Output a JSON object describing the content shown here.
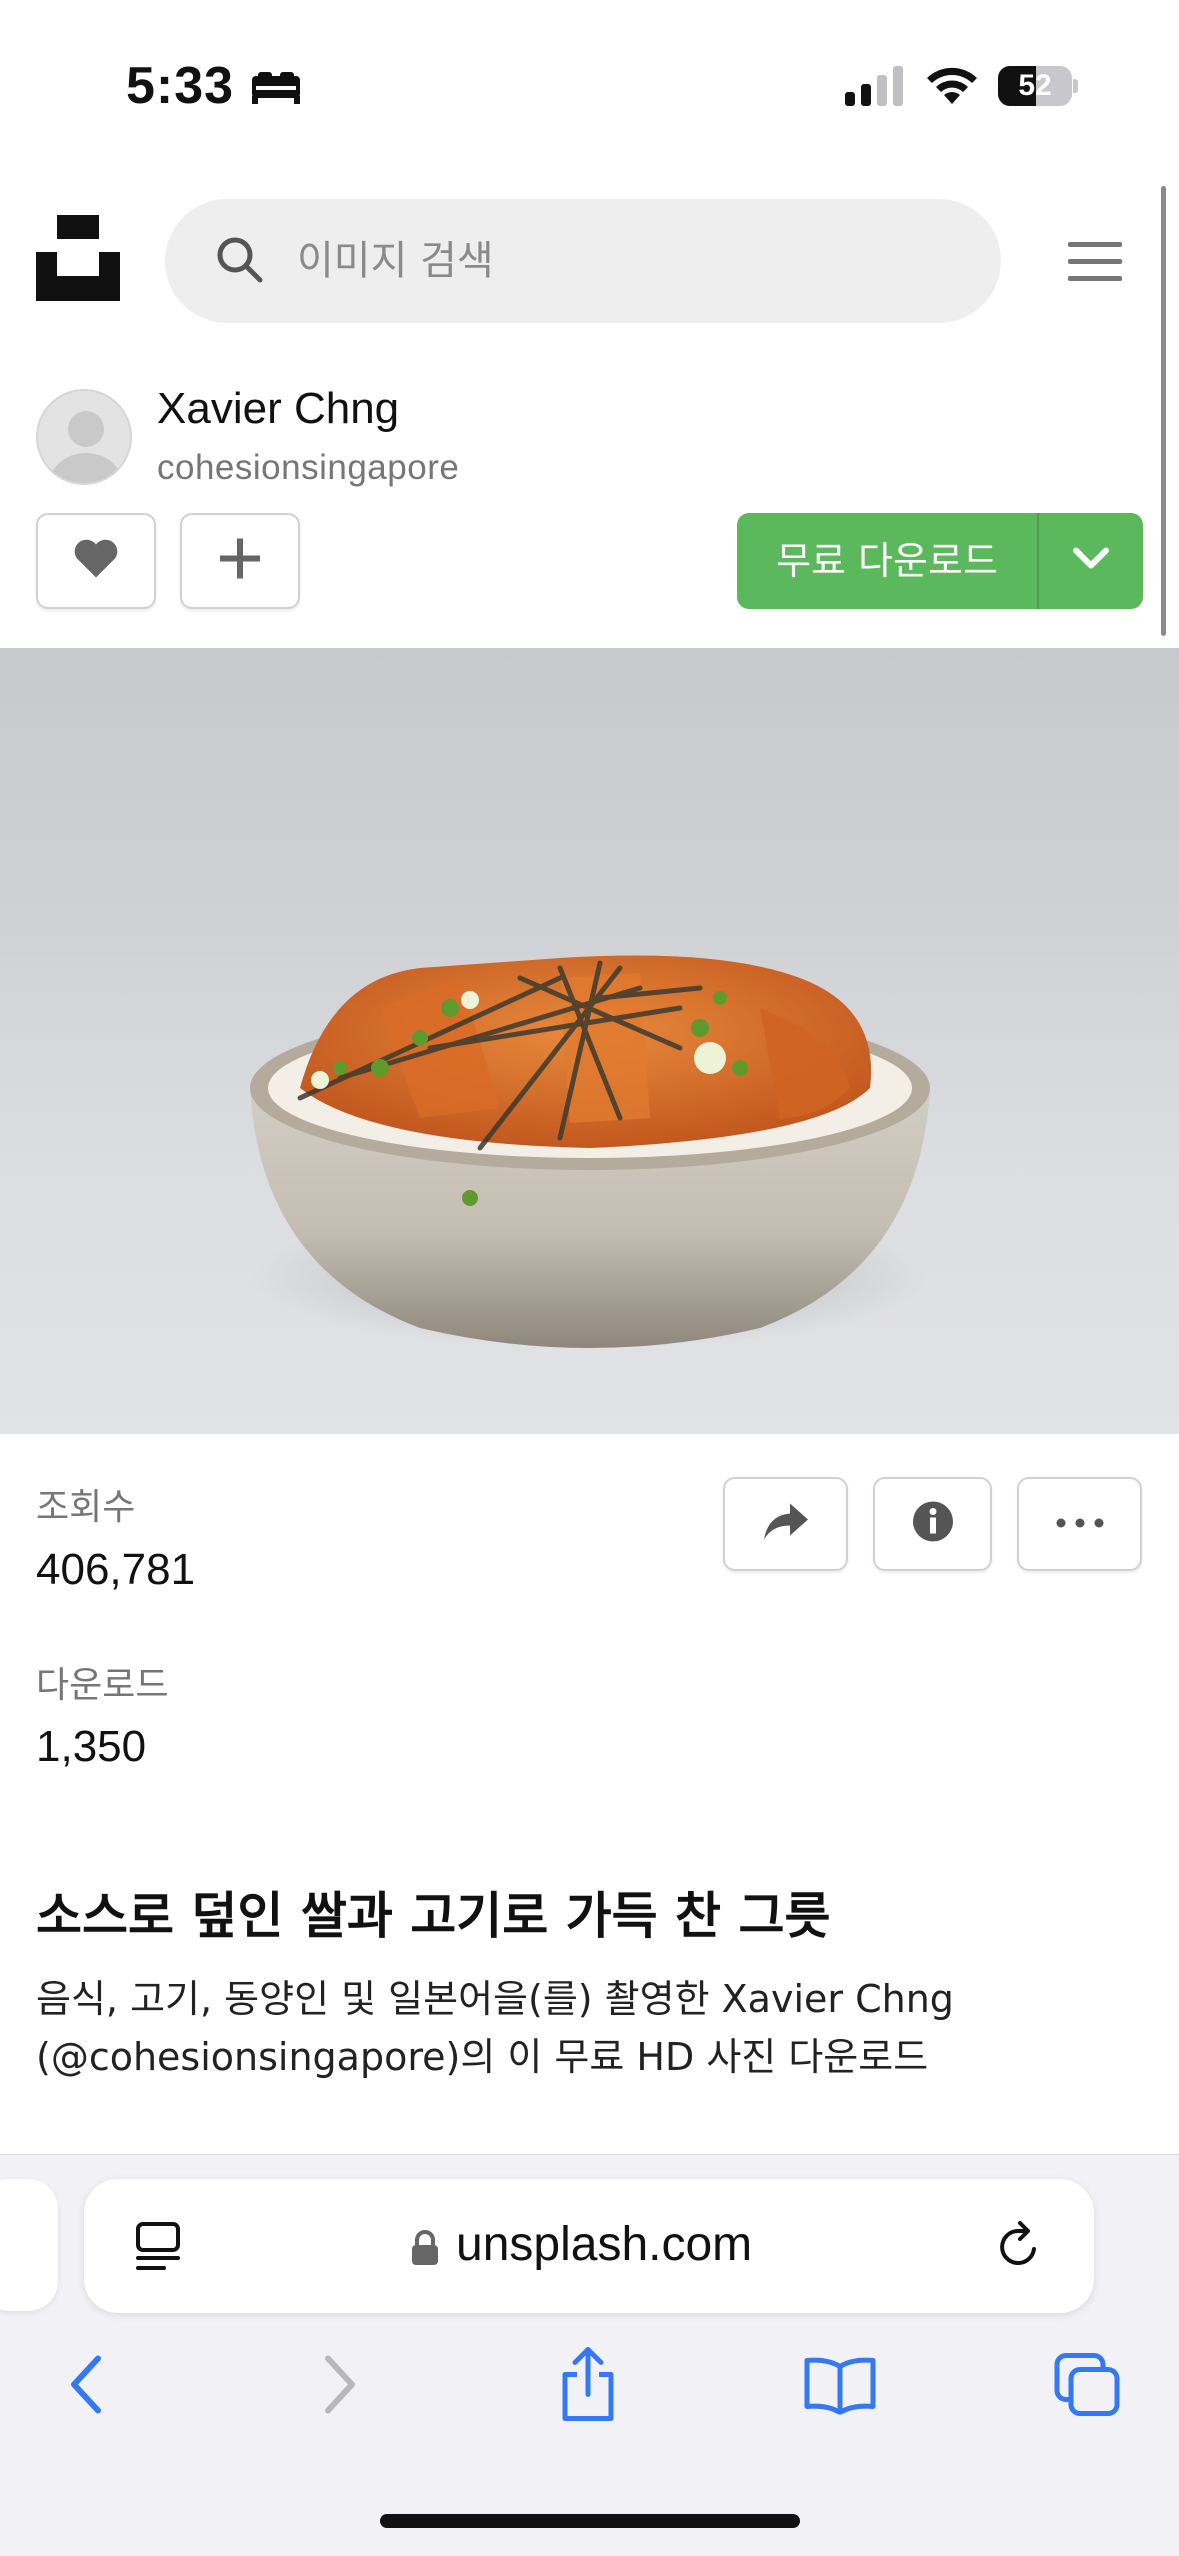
{
  "status_bar": {
    "time": "5:33",
    "battery": "52",
    "battery_level": 0.52
  },
  "search": {
    "placeholder": "이미지 검색"
  },
  "author": {
    "name": "Xavier Chng",
    "handle": "cohesionsingapore"
  },
  "download": {
    "label": "무료 다운로드"
  },
  "stats": {
    "views_label": "조회수",
    "views_value": "406,781",
    "downloads_label": "다운로드",
    "downloads_value": "1,350"
  },
  "description": {
    "title": "소스로 덮인 쌀과 고기로 가득 찬 그릇",
    "line1": "음식, 고기, 동양인 및 일본어을(를) 촬영한 Xavier Chng",
    "line2": "(@cohesionsingapore)의 이 무료 HD 사진 다운로드"
  },
  "browser": {
    "url": "unsplash.com"
  },
  "colors": {
    "accent_green": "#5cb85c",
    "ios_blue": "#3478f6"
  },
  "icons": [
    "search-icon",
    "menu-icon",
    "heart-icon",
    "plus-icon",
    "chevron-down-icon",
    "share-icon",
    "info-icon",
    "more-icon",
    "reader-icon",
    "lock-icon",
    "reload-icon",
    "back-icon",
    "forward-icon",
    "share-sheet-icon",
    "bookmarks-icon",
    "tabs-icon"
  ]
}
